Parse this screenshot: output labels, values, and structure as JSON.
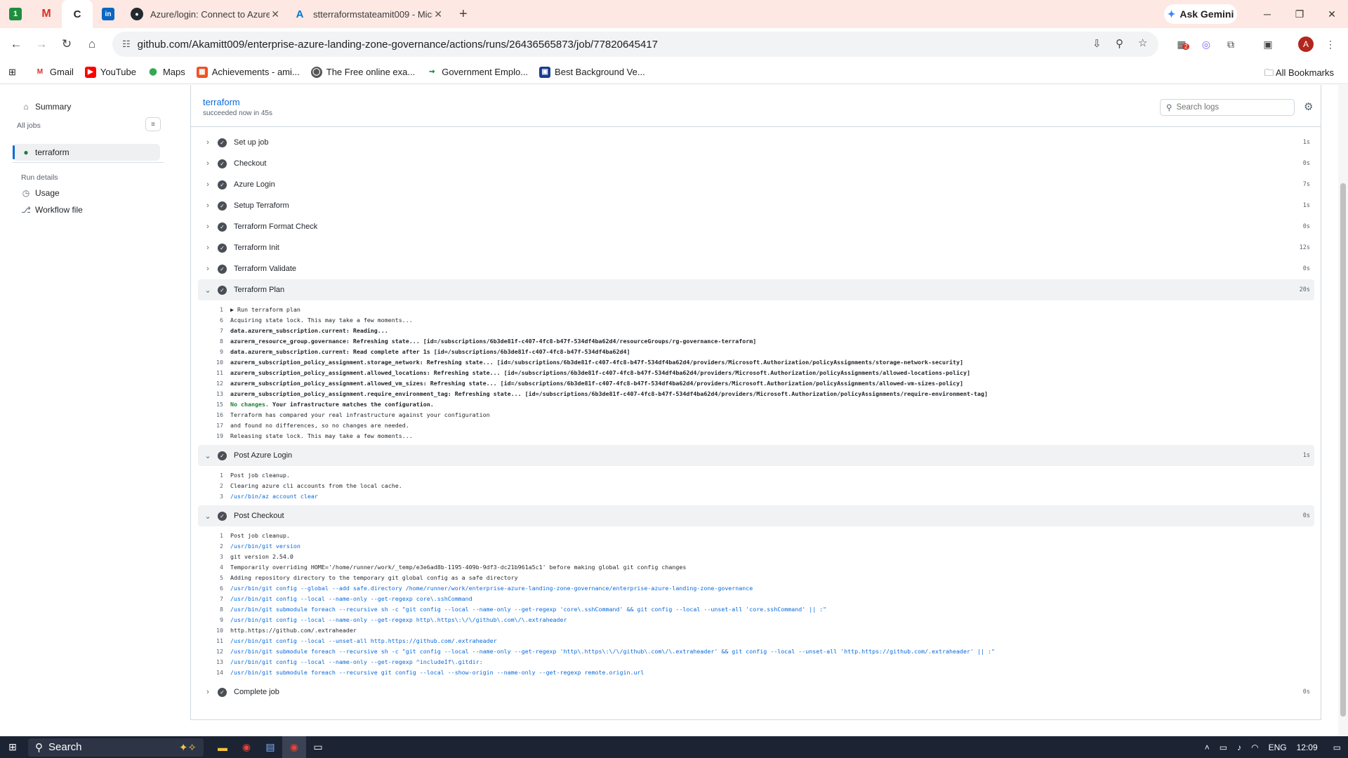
{
  "browser": {
    "tabs": [
      {
        "label": "",
        "icon": "1"
      },
      {
        "label": "",
        "icon": "M"
      },
      {
        "label": "",
        "icon": "C"
      },
      {
        "label": "",
        "icon": "in"
      },
      {
        "label": "Azure/login: Connect to Azure",
        "icon": "gh"
      },
      {
        "label": "stterraformstateamit009 - Micr",
        "icon": "A"
      }
    ],
    "ask_gemini": "Ask Gemini",
    "url": "github.com/Akamitt009/enterprise-azure-landing-zone-governance/actions/runs/26436565873/job/77820645417",
    "extension_badge": "2",
    "avatar_letter": "A",
    "bookmarks": [
      "Gmail",
      "YouTube",
      "Maps",
      "Achievements - ami...",
      "The Free online exa...",
      "Government Emplo...",
      "Best Background Ve..."
    ],
    "all_bookmarks": "All Bookmarks"
  },
  "sidebar": {
    "summary": "Summary",
    "all_jobs": "All jobs",
    "job": "terraform",
    "run_details": "Run details",
    "usage": "Usage",
    "workflow_file": "Workflow file"
  },
  "job": {
    "title": "terraform",
    "subtitle": "succeeded now in 45s",
    "search_placeholder": "Search logs"
  },
  "steps": [
    {
      "name": "Set up job",
      "duration": "1s",
      "open": false
    },
    {
      "name": "Checkout",
      "duration": "0s",
      "open": false
    },
    {
      "name": "Azure Login",
      "duration": "7s",
      "open": false
    },
    {
      "name": "Setup Terraform",
      "duration": "1s",
      "open": false
    },
    {
      "name": "Terraform Format Check",
      "duration": "0s",
      "open": false
    },
    {
      "name": "Terraform Init",
      "duration": "12s",
      "open": false
    },
    {
      "name": "Terraform Validate",
      "duration": "0s",
      "open": false
    },
    {
      "name": "Terraform Plan",
      "duration": "20s",
      "open": true,
      "lines": [
        {
          "n": "1",
          "t": "▶ Run terraform plan",
          "k": ""
        },
        {
          "n": "6",
          "t": "Acquiring state lock. This may take a few moments...",
          "k": ""
        },
        {
          "n": "7",
          "t": "data.azurerm_subscription.current: Reading...",
          "k": "bold"
        },
        {
          "n": "8",
          "t": "azurerm_resource_group.governance: Refreshing state... [id=/subscriptions/6b3de81f-c407-4fc8-b47f-534df4ba62d4/resourceGroups/rg-governance-terraform]",
          "k": "bold"
        },
        {
          "n": "9",
          "t": "data.azurerm_subscription.current: Read complete after 1s [id=/subscriptions/6b3de81f-c407-4fc8-b47f-534df4ba62d4]",
          "k": "bold"
        },
        {
          "n": "10",
          "t": "azurerm_subscription_policy_assignment.storage_network: Refreshing state... [id=/subscriptions/6b3de81f-c407-4fc8-b47f-534df4ba62d4/providers/Microsoft.Authorization/policyAssignments/storage-network-security]",
          "k": "bold"
        },
        {
          "n": "11",
          "t": "azurerm_subscription_policy_assignment.allowed_locations: Refreshing state... [id=/subscriptions/6b3de81f-c407-4fc8-b47f-534df4ba62d4/providers/Microsoft.Authorization/policyAssignments/allowed-locations-policy]",
          "k": "bold"
        },
        {
          "n": "12",
          "t": "azurerm_subscription_policy_assignment.allowed_vm_sizes: Refreshing state... [id=/subscriptions/6b3de81f-c407-4fc8-b47f-534df4ba62d4/providers/Microsoft.Authorization/policyAssignments/allowed-vm-sizes-policy]",
          "k": "bold"
        },
        {
          "n": "13",
          "t": "azurerm_subscription_policy_assignment.require_environment_tag: Refreshing state... [id=/subscriptions/6b3de81f-c407-4fc8-b47f-534df4ba62d4/providers/Microsoft.Authorization/policyAssignments/require-environment-tag]",
          "k": "bold"
        },
        {
          "n": "15",
          "t": "No changes.",
          "t2": " Your infrastructure matches the configuration.",
          "k": "green"
        },
        {
          "n": "16",
          "t": "Terraform has compared your real infrastructure against your configuration",
          "k": ""
        },
        {
          "n": "17",
          "t": "and found no differences, so no changes are needed.",
          "k": ""
        },
        {
          "n": "19",
          "t": "Releasing state lock. This may take a few moments...",
          "k": ""
        }
      ]
    },
    {
      "name": "Post Azure Login",
      "duration": "1s",
      "open": true,
      "lines": [
        {
          "n": "1",
          "t": "Post job cleanup.",
          "k": ""
        },
        {
          "n": "2",
          "t": "Clearing azure cli accounts from the local cache.",
          "k": ""
        },
        {
          "n": "3",
          "t": "/usr/bin/az account clear",
          "k": "cmd"
        }
      ]
    },
    {
      "name": "Post Checkout",
      "duration": "0s",
      "open": true,
      "lines": [
        {
          "n": "1",
          "t": "Post job cleanup.",
          "k": ""
        },
        {
          "n": "2",
          "t": "/usr/bin/git version",
          "k": "cmd"
        },
        {
          "n": "3",
          "t": "git version 2.54.0",
          "k": ""
        },
        {
          "n": "4",
          "t": "Temporarily overriding HOME='/home/runner/work/_temp/e3e6ad8b-1195-409b-9df3-dc21b961a5c1' before making global git config changes",
          "k": ""
        },
        {
          "n": "5",
          "t": "Adding repository directory to the temporary git global config as a safe directory",
          "k": ""
        },
        {
          "n": "6",
          "t": "/usr/bin/git config --global --add safe.directory /home/runner/work/enterprise-azure-landing-zone-governance/enterprise-azure-landing-zone-governance",
          "k": "cmd"
        },
        {
          "n": "7",
          "t": "/usr/bin/git config --local --name-only --get-regexp core\\.sshCommand",
          "k": "cmd"
        },
        {
          "n": "8",
          "t": "/usr/bin/git submodule foreach --recursive sh -c \"git config --local --name-only --get-regexp 'core\\.sshCommand' && git config --local --unset-all 'core.sshCommand' || :\"",
          "k": "cmd"
        },
        {
          "n": "9",
          "t": "/usr/bin/git config --local --name-only --get-regexp http\\.https\\:\\/\\/github\\.com\\/\\.extraheader",
          "k": "cmd"
        },
        {
          "n": "10",
          "t": "http.https://github.com/.extraheader",
          "k": ""
        },
        {
          "n": "11",
          "t": "/usr/bin/git config --local --unset-all http.https://github.com/.extraheader",
          "k": "cmd"
        },
        {
          "n": "12",
          "t": "/usr/bin/git submodule foreach --recursive sh -c \"git config --local --name-only --get-regexp 'http\\.https\\:\\/\\/github\\.com\\/\\.extraheader' && git config --local --unset-all 'http.https://github.com/.extraheader' || :\"",
          "k": "cmd"
        },
        {
          "n": "13",
          "t": "/usr/bin/git config --local --name-only --get-regexp ^includeIf\\.gitdir:",
          "k": "cmd"
        },
        {
          "n": "14",
          "t": "/usr/bin/git submodule foreach --recursive git config --local --show-origin --name-only --get-regexp remote.origin.url",
          "k": "cmd"
        }
      ]
    },
    {
      "name": "Complete job",
      "duration": "0s",
      "open": false
    }
  ],
  "taskbar": {
    "search": "Search",
    "lang": "ENG",
    "time": "12:09"
  }
}
